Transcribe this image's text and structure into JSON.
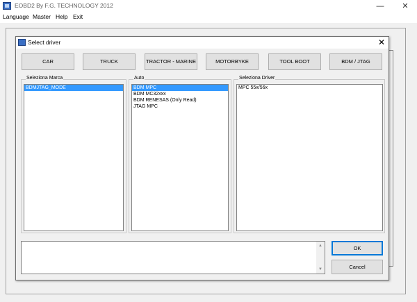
{
  "app": {
    "title": "EOBD2 By F.G. TECHNOLOGY 2012",
    "minimize_glyph": "—",
    "close_glyph": "✕"
  },
  "menu": {
    "items": [
      {
        "label": "Language"
      },
      {
        "label": "Master"
      },
      {
        "label": "Help"
      },
      {
        "label": "Exit"
      }
    ]
  },
  "dialog": {
    "title": "Select driver",
    "close_glyph": "✕",
    "category_buttons": [
      {
        "label": "CAR"
      },
      {
        "label": "TRUCK"
      },
      {
        "label": "TRACTOR - MARINE"
      },
      {
        "label": "MOTORBYKE"
      },
      {
        "label": "TOOL BOOT"
      },
      {
        "label": "BDM / JTAG"
      }
    ],
    "brand_group": {
      "label": "Seleziona Marca",
      "items": [
        "BDMJTAG_MODE"
      ],
      "selected_index": 0
    },
    "auto_group": {
      "label": "Auto",
      "items": [
        "BDM MPC",
        "BDM MC32xxx",
        "BDM RENESAS (Only Read)",
        "JTAG MPC"
      ],
      "selected_index": 0
    },
    "driver_group": {
      "label": "Seleziona Driver",
      "items": [
        "MPC 55x/56x"
      ]
    },
    "ok_label": "OK",
    "cancel_label": "Cancel"
  }
}
